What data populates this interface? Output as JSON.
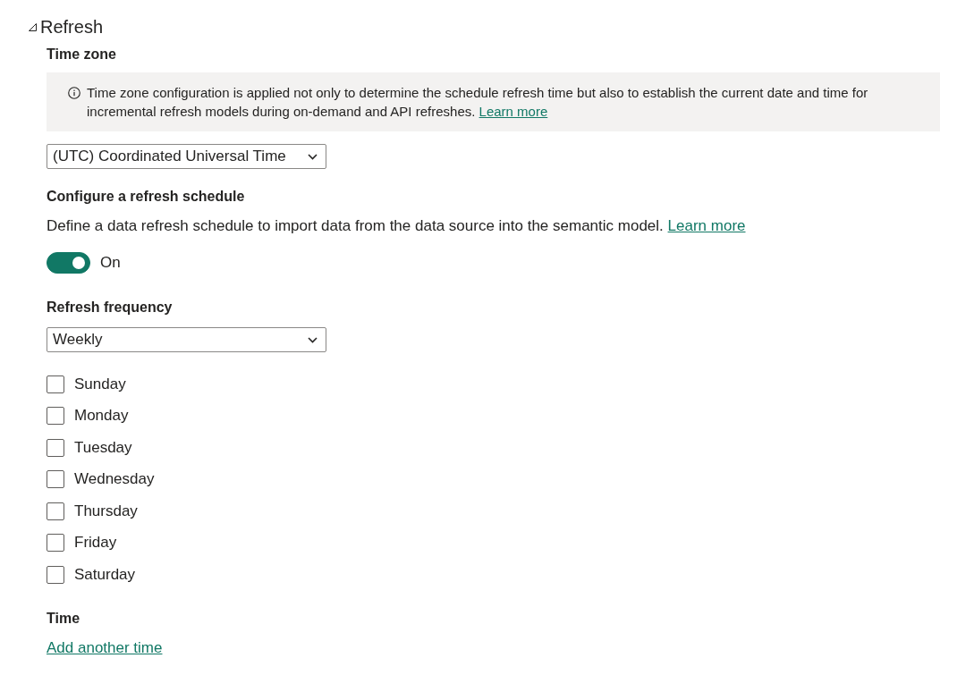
{
  "section": {
    "title": "Refresh",
    "expanded": true
  },
  "time_zone": {
    "label": "Time zone",
    "info": {
      "text": "Time zone configuration is applied not only to determine the schedule refresh time but also to establish the current date and time for incremental refresh models during on-demand and API refreshes.",
      "link": "Learn more"
    },
    "select": {
      "value": "(UTC) Coordinated Universal Time"
    }
  },
  "schedule": {
    "title": "Configure a refresh schedule",
    "description": "Define a data refresh schedule to import data from the data source into the semantic model.",
    "link": "Learn more",
    "toggle": {
      "on": true,
      "label": "On"
    }
  },
  "frequency": {
    "label": "Refresh frequency",
    "select": {
      "value": "Weekly"
    },
    "days": [
      {
        "label": "Sunday",
        "checked": false
      },
      {
        "label": "Monday",
        "checked": false
      },
      {
        "label": "Tuesday",
        "checked": false
      },
      {
        "label": "Wednesday",
        "checked": false
      },
      {
        "label": "Thursday",
        "checked": false
      },
      {
        "label": "Friday",
        "checked": false
      },
      {
        "label": "Saturday",
        "checked": false
      }
    ]
  },
  "time": {
    "label": "Time",
    "link": "Add another time"
  }
}
